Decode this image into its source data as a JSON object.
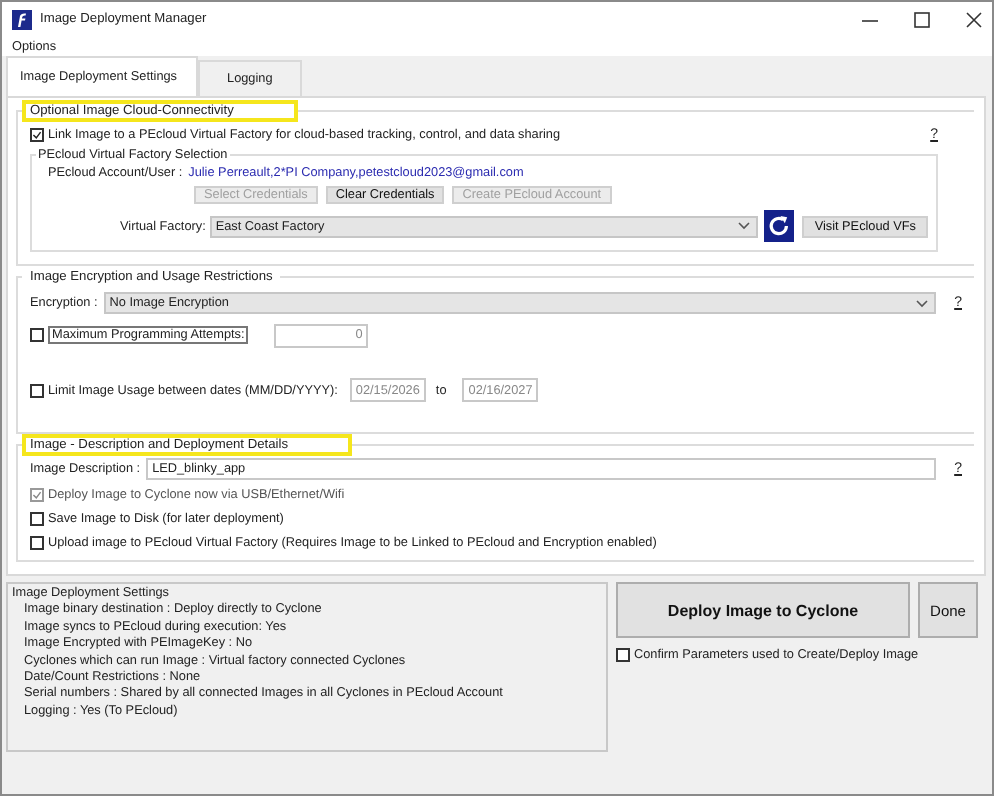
{
  "window": {
    "title": "Image Deployment Manager"
  },
  "menu": [
    {
      "label": "Options"
    }
  ],
  "tabs": [
    {
      "label": "Image Deployment Settings",
      "selected": true
    },
    {
      "label": "Logging",
      "selected": false
    }
  ],
  "cloud_section": {
    "title": "Optional Image Cloud-Connectivity",
    "highlighted": true,
    "help": "?",
    "link_checkbox": {
      "label": "Link Image to a PEcloud Virtual Factory for cloud-based tracking, control, and data sharing",
      "checked": true
    },
    "factory_group": {
      "title": "PEcloud Virtual Factory Selection",
      "account_label": "PEcloud Account/User :",
      "account_value": "Julie Perreault,2*PI Company,petestcloud2023@gmail.com",
      "buttons": [
        {
          "label": "Select Credentials",
          "disabled": true
        },
        {
          "label": "Clear Credentials",
          "disabled": false
        },
        {
          "label": "Create PEcloud Account",
          "disabled": true
        }
      ],
      "factory_label": "Virtual Factory:",
      "factory_value": "East Coast Factory",
      "visit_button": "Visit PEcloud VFs"
    }
  },
  "encryption_section": {
    "title": "Image Encryption and Usage Restrictions",
    "highlighted": false,
    "help": "?",
    "encryption_label": "Encryption :",
    "encryption_value": "No Image Encryption",
    "max_attempts": {
      "label": "Maximum Programming Attempts:",
      "checked": false,
      "value": "0",
      "disabled": true
    },
    "date_limit": {
      "label": "Limit Image Usage between dates (MM/DD/YYYY):",
      "checked": false,
      "from": "02/15/2026",
      "to_label": "to",
      "to": "02/16/2027",
      "disabled": true
    }
  },
  "details_section": {
    "title": "Image - Description and Deployment Details",
    "highlighted": true,
    "help": "?",
    "description_label": "Image Description :",
    "description_value": "LED_blinky_app",
    "options": [
      {
        "label": "Deploy Image to Cyclone now via USB/Ethernet/Wifi",
        "checked": true,
        "disabled": true
      },
      {
        "label": "Save Image to Disk (for later deployment)",
        "checked": false,
        "disabled": false
      },
      {
        "label": "Upload image to PEcloud Virtual Factory (Requires Image to be Linked to PEcloud and Encryption enabled)",
        "checked": false,
        "disabled": false
      }
    ]
  },
  "summary": {
    "title": "Image Deployment Settings",
    "lines": [
      "Image binary destination : Deploy directly to Cyclone",
      "Image syncs to PEcloud during execution: Yes",
      "Image Encrypted with PEImageKey : No",
      "Cyclones which can run Image : Virtual factory connected Cyclones",
      "Date/Count Restrictions : None",
      "Serial numbers : Shared by all connected Images in all Cyclones in PEcloud Account",
      "Logging : Yes (To PEcloud)"
    ]
  },
  "deploy_button": "Deploy Image to Cyclone",
  "done_button": "Done",
  "confirm": {
    "label": "Confirm Parameters used to Create/Deploy Image",
    "checked": false
  }
}
